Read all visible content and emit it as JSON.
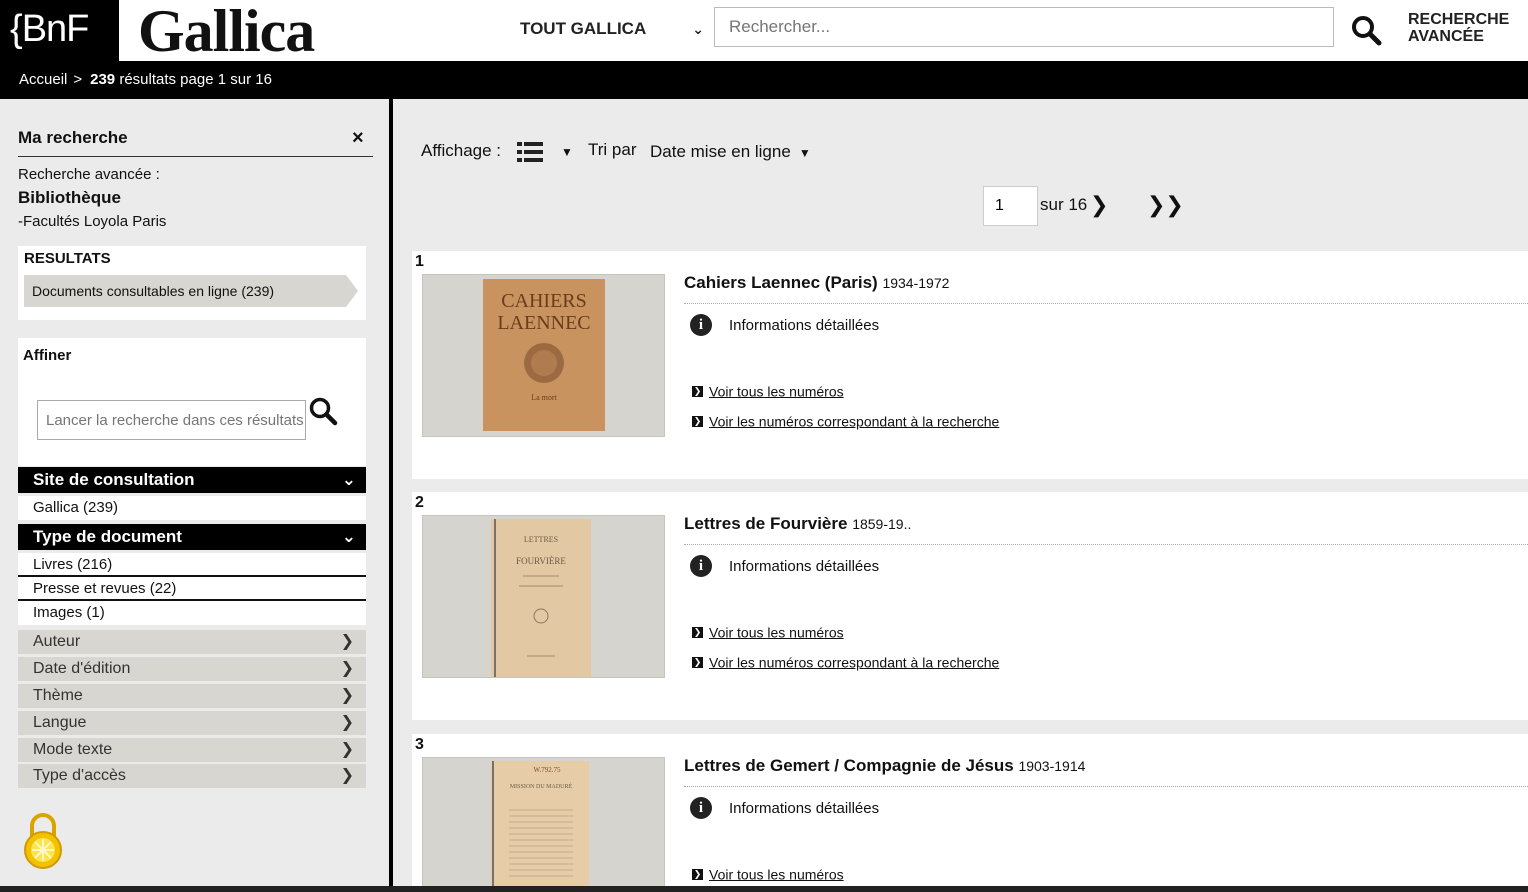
{
  "header": {
    "bnf_logo": "{BnF",
    "gallica_logo": "Gallica",
    "scope_select": "TOUT GALLICA",
    "search_placeholder": "Rechercher...",
    "advanced_search_line1": "RECHERCHE",
    "advanced_search_line2": "AVANCÉE"
  },
  "breadcrumb": {
    "home": "Accueil",
    "separator": ">",
    "count": "239",
    "summary": "résultats page 1 sur 16"
  },
  "sidebar": {
    "my_search_title": "Ma recherche",
    "close": "×",
    "advanced_label": "Recherche avancée :",
    "library_label": "Bibliothèque",
    "library_value": "-Facultés Loyola Paris",
    "results_title": "RESULTATS",
    "results_item": "Documents consultables en ligne (239)",
    "refine_title": "Affiner",
    "refine_placeholder": "Lancer la recherche dans ces résultats",
    "facets": {
      "site": {
        "title": "Site de consultation",
        "items": [
          "Gallica (239)"
        ]
      },
      "doctype": {
        "title": "Type de document",
        "items": [
          "Livres (216)",
          "Presse et revues (22)",
          "Images (1)"
        ]
      },
      "collapsed": [
        "Auteur",
        "Date d'édition",
        "Thème",
        "Langue",
        "Mode texte",
        "Type d'accès"
      ]
    }
  },
  "toolbar": {
    "display_label": "Affichage :",
    "sort_label": "Tri par",
    "sort_value": "Date mise en ligne",
    "page_value": "1",
    "page_of": "sur 16"
  },
  "results": [
    {
      "num": "1",
      "title": "Cahiers Laennec (Paris)",
      "dates": "1934-1972",
      "info": "Informations détaillées",
      "link_all": "Voir tous les numéros",
      "link_match": "Voir les numéros correspondant à la recherche",
      "thumb_text1": "CAHIERS",
      "thumb_text2": "LAENNEC",
      "thumb_text3": "La mort"
    },
    {
      "num": "2",
      "title": "Lettres de Fourvière",
      "dates": "1859-19..",
      "info": "Informations détaillées",
      "link_all": "Voir tous les numéros",
      "link_match": "Voir les numéros correspondant à la recherche",
      "thumb_text1": "LETTRES",
      "thumb_text2": "FOURVIÈRE"
    },
    {
      "num": "3",
      "title": "Lettres de Gemert / Compagnie de Jésus",
      "dates": "1903-1914",
      "info": "Informations détaillées",
      "link_all": "Voir tous les numéros",
      "thumb_text1": "W.792.75",
      "thumb_text2": "MISSION DU MADURÉ"
    }
  ]
}
